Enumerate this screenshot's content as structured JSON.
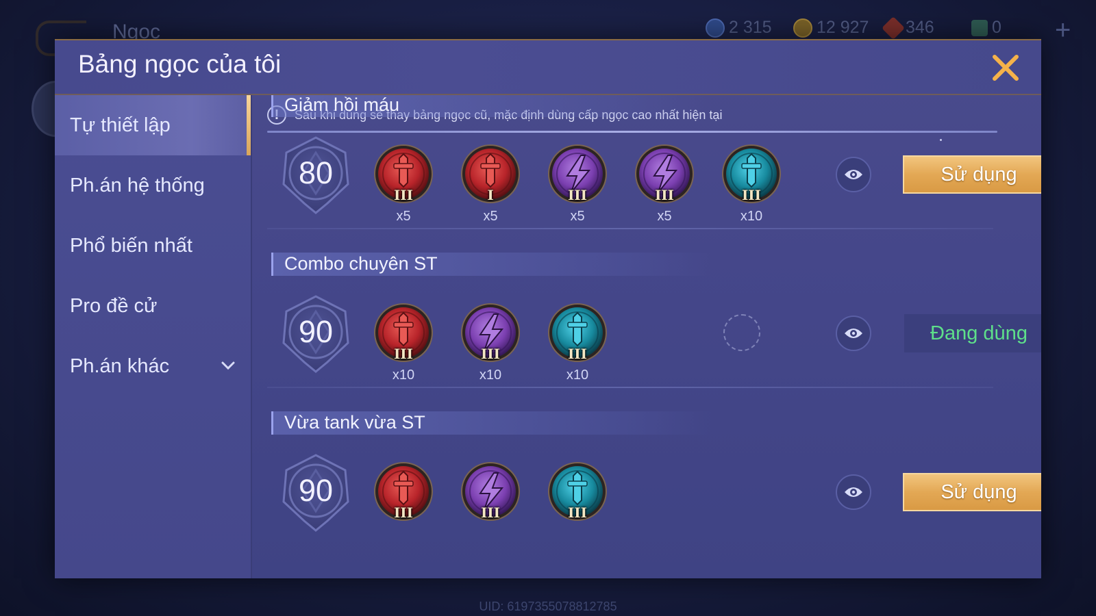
{
  "background": {
    "title": "Ngọc",
    "currencies": [
      {
        "icon": "blue-gem-coin-icon",
        "value": "2 315",
        "color": "#3f5da8"
      },
      {
        "icon": "gold-coin-icon",
        "value": "12 927",
        "color": "#c09a35"
      },
      {
        "icon": "red-ruby-icon",
        "value": "346",
        "color": "#c0463a"
      },
      {
        "icon": "green-voucher-icon",
        "value": "0",
        "color": "#3d8f6f"
      }
    ],
    "uid": "UID: 6197355078812785"
  },
  "dialog": {
    "title": "Bảng ngọc của tôi",
    "notice": "Sau khi dùng sẽ thay bảng ngọc cũ, mặc định dùng cấp ngọc cao nhất hiện tại",
    "sidebar": [
      {
        "label": "Tự thiết lập",
        "active": true
      },
      {
        "label": "Ph.án hệ thống"
      },
      {
        "label": "Phổ biến nhất"
      },
      {
        "label": "Pro đề cử"
      },
      {
        "label": "Ph.án khác",
        "has_dropdown": true
      }
    ]
  },
  "gem_colors": {
    "red": "#b8242a",
    "purple": "#7b3fb0",
    "teal": "#178a9e"
  },
  "sections": [
    {
      "title": "Giảm hồi máu",
      "level": "80",
      "gems": [
        {
          "color": "red",
          "icon": "red-sword-gem-icon",
          "tier": "III",
          "count": "x5"
        },
        {
          "color": "red",
          "icon": "red-sword-gem-icon",
          "tier": "I",
          "count": "x5"
        },
        {
          "color": "purple",
          "icon": "purple-lightning-gem-icon",
          "tier": "III",
          "count": "x5"
        },
        {
          "color": "purple",
          "icon": "purple-lightning-gem-icon",
          "tier": "III",
          "count": "x5"
        },
        {
          "color": "teal",
          "icon": "teal-sword-gem-icon",
          "tier": "III",
          "count": "x10"
        }
      ],
      "action": "Sử dụng",
      "in_use": false
    },
    {
      "title": "Combo chuyên ST",
      "level": "90",
      "gems": [
        {
          "color": "red",
          "icon": "red-sword-gem-icon",
          "tier": "III",
          "count": "x10"
        },
        {
          "color": "purple",
          "icon": "purple-lightning-gem-icon",
          "tier": "III",
          "count": "x10"
        },
        {
          "color": "teal",
          "icon": "teal-sword-gem-icon",
          "tier": "III",
          "count": "x10"
        }
      ],
      "action": "Đang dùng",
      "in_use": true
    },
    {
      "title": "Vừa tank vừa ST",
      "level": "90",
      "gems": [
        {
          "color": "red",
          "icon": "red-sword-gem-icon",
          "tier": "III",
          "count": ""
        },
        {
          "color": "purple",
          "icon": "purple-lightning-gem-icon",
          "tier": "III",
          "count": ""
        },
        {
          "color": "teal",
          "icon": "teal-sword-gem-icon",
          "tier": "III",
          "count": ""
        }
      ],
      "action": "Sử dụng",
      "in_use": false
    }
  ]
}
